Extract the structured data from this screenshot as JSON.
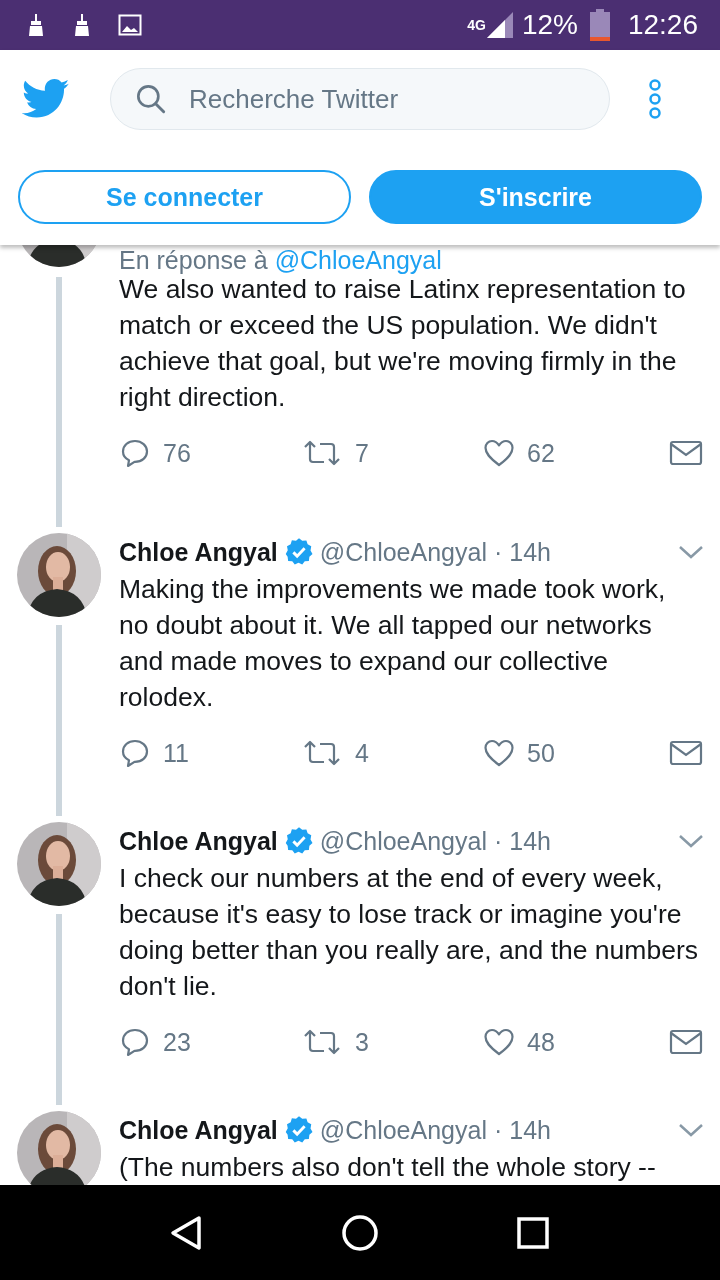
{
  "status_bar": {
    "network": "4G",
    "battery": "12%",
    "time": "12:26"
  },
  "header": {
    "search": {
      "placeholder": "Recherche Twitter"
    },
    "buttons": [
      {
        "label": "Se connecter",
        "kind": "outline"
      },
      {
        "label": "S'inscrire",
        "kind": "filled"
      }
    ]
  },
  "tweets": [
    {
      "reply_to": {
        "prefix": "En réponse à",
        "handle": "@ChloeAngyal"
      },
      "text": "We also wanted to raise Latinx representation to match or exceed the US population. We didn't achieve that goal, but we're moving firmly in the right direction.",
      "replies": "76",
      "retweets": "7",
      "likes": "62"
    },
    {
      "name": "Chloe Angyal",
      "verified": true,
      "handle": "@ChloeAngyal",
      "time": "· 14h",
      "text": "Making the improvements we made took work, no doubt about it. We all tapped our networks and made moves to expand our collective rolodex.",
      "replies": "11",
      "retweets": "4",
      "likes": "50"
    },
    {
      "name": "Chloe Angyal",
      "verified": true,
      "handle": "@ChloeAngyal",
      "time": "· 14h",
      "text": "I check our numbers at the end of every week, because it's easy to lose track or imagine you're doing better than you really are, and the numbers don't lie.",
      "replies": "23",
      "retweets": "3",
      "likes": "48"
    },
    {
      "name": "Chloe Angyal",
      "verified": true,
      "handle": "@ChloeAngyal",
      "time": "· 14h",
      "text": "(The numbers also don't tell the whole story --"
    }
  ]
}
